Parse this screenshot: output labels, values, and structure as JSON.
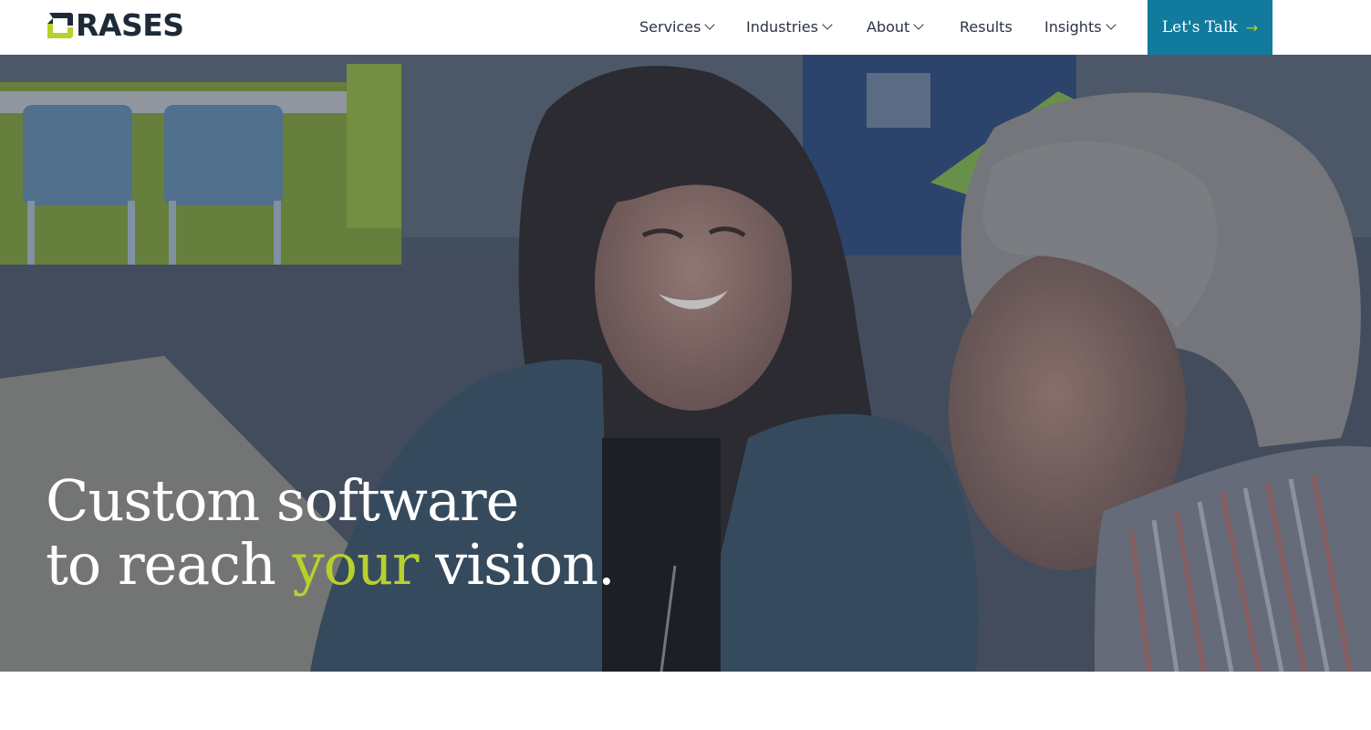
{
  "brand": {
    "name": "ORASES",
    "logo_text": "RASES",
    "colors": {
      "navy": "#1e2a38",
      "accent_green": "#b7d12d",
      "cta_blue": "#117a9d"
    }
  },
  "nav": {
    "items": [
      {
        "label": "Services",
        "has_dropdown": true
      },
      {
        "label": "Industries",
        "has_dropdown": true
      },
      {
        "label": "About",
        "has_dropdown": true
      },
      {
        "label": "Results",
        "has_dropdown": false
      },
      {
        "label": "Insights",
        "has_dropdown": true
      }
    ],
    "cta_label": "Let's Talk",
    "cta_icon": "arrow-right-icon"
  },
  "hero": {
    "line1": "Custom software",
    "line2_start": "to reach ",
    "line2_accent": "your",
    "line2_end": " vision."
  }
}
